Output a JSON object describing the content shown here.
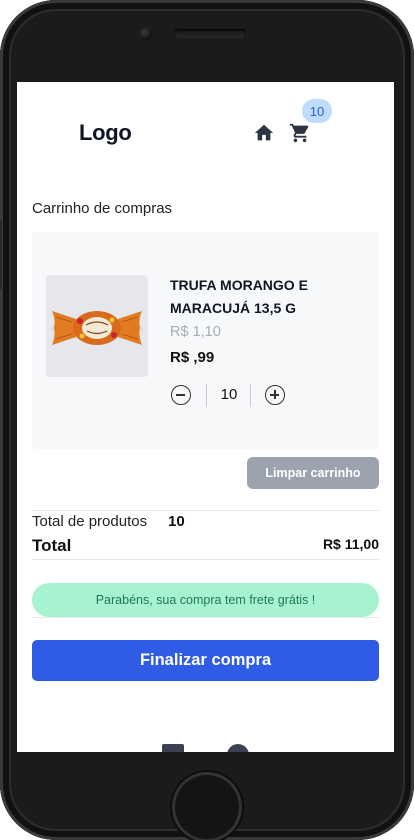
{
  "header": {
    "logo": "Logo",
    "home_icon": "home-icon",
    "cart_icon": "cart-icon",
    "cart_count": "10",
    "badge_color": "#bfdbfe"
  },
  "cart": {
    "title": "Carrinho de compras",
    "items": [
      {
        "name": "TRUFA MORANGO E MARACUJÁ 13,5 G",
        "price_old": "R$ 1,10",
        "price_new": "R$ ,99",
        "quantity": "10"
      }
    ],
    "clear_label": "Limpar carrinho"
  },
  "summary": {
    "total_products_label": "Total de produtos",
    "total_products_value": "10",
    "total_label": "Total",
    "total_value": "R$ 11,00"
  },
  "notice": {
    "free_shipping": "Parabéns, sua compra tem frete grátis !"
  },
  "checkout": {
    "label": "Finalizar compra",
    "color": "#2f5be5"
  }
}
